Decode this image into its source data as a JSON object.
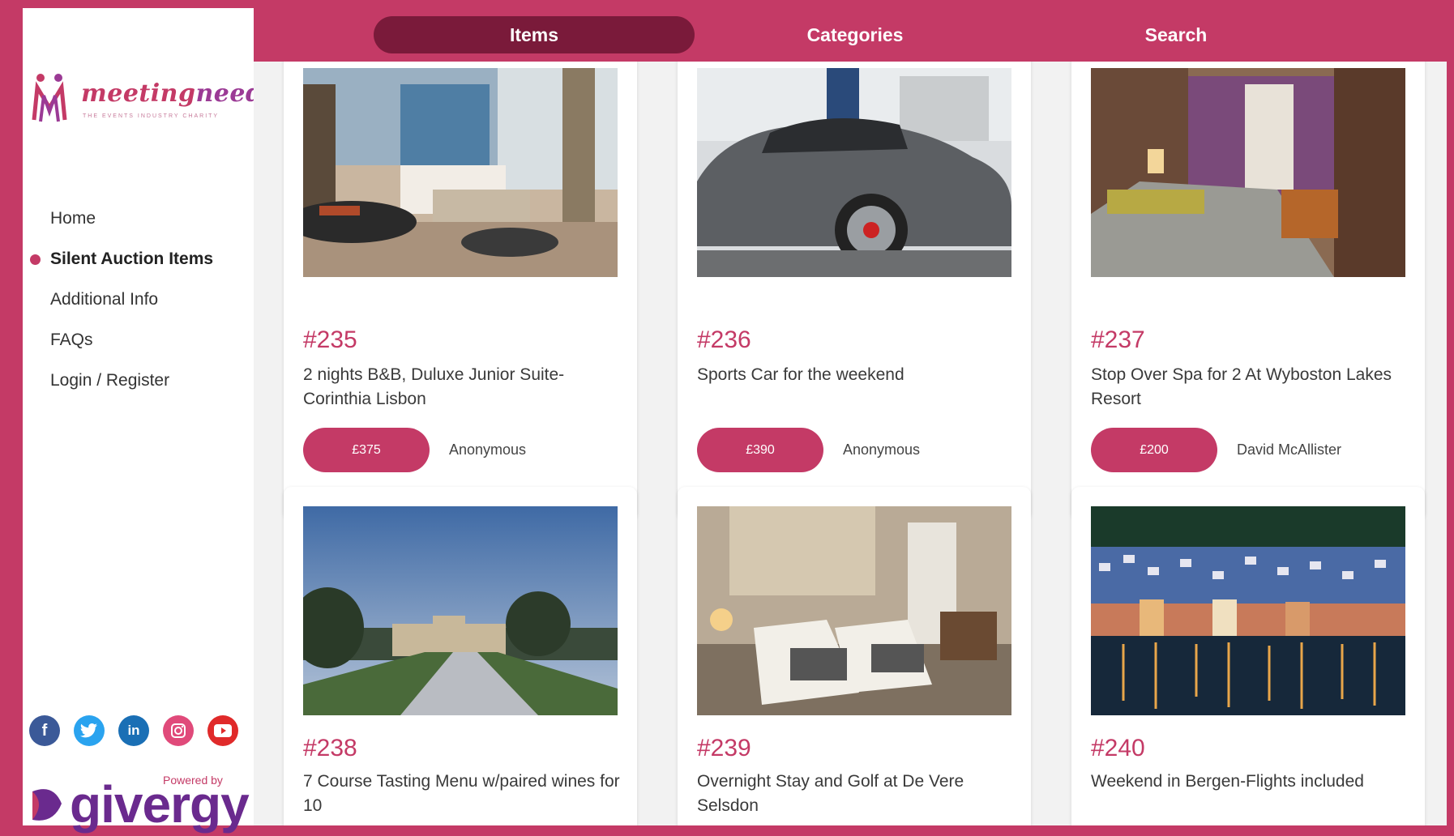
{
  "brand": {
    "logo_text_1": "meeting",
    "logo_text_2": "needs",
    "logo_tagline": "THE EVENTS INDUSTRY CHARITY",
    "powered_by": "Powered by",
    "givergy": "givergy"
  },
  "colors": {
    "accent": "#c43a66",
    "tab_active": "#7a1a3a",
    "background": "#f2f2f2"
  },
  "nav": {
    "items": [
      {
        "label": "Home",
        "active": false
      },
      {
        "label": "Silent Auction Items",
        "active": true
      },
      {
        "label": "Additional Info",
        "active": false
      },
      {
        "label": "FAQs",
        "active": false
      },
      {
        "label": "Login / Register",
        "active": false
      }
    ]
  },
  "social": [
    "facebook-icon",
    "twitter-icon",
    "linkedin-icon",
    "instagram-icon",
    "youtube-icon"
  ],
  "tabs": [
    {
      "label": "Items",
      "active": true
    },
    {
      "label": "Categories",
      "active": false
    },
    {
      "label": "Search",
      "active": false
    }
  ],
  "items": [
    {
      "lot": "#235",
      "title": "2 nights B&B, Duluxe Junior Suite-Corinthia Lisbon",
      "bid": "£375",
      "bidder": "Anonymous",
      "image": "hotel-suite-image"
    },
    {
      "lot": "#236",
      "title": "Sports Car for the weekend",
      "bid": "£390",
      "bidder": "Anonymous",
      "image": "sports-car-image"
    },
    {
      "lot": "#237",
      "title": "Stop Over Spa for 2 At Wyboston Lakes Resort",
      "bid": "£200",
      "bidder": "David McAllister",
      "image": "hotel-room-image"
    },
    {
      "lot": "#238",
      "title": "7 Course Tasting Menu w/paired wines for 10",
      "image": "country-house-image"
    },
    {
      "lot": "#239",
      "title": "Overnight Stay and Golf at De Vere Selsdon",
      "image": "twin-room-image"
    },
    {
      "lot": "#240",
      "title": "Weekend in Bergen-Flights included",
      "image": "bergen-harbour-image"
    }
  ]
}
